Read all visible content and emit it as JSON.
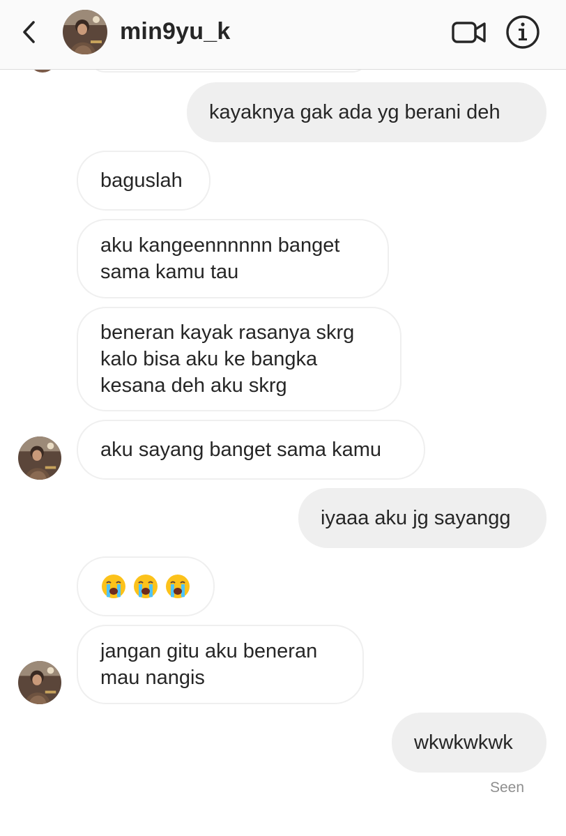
{
  "header": {
    "username": "min9yu_k",
    "icons": {
      "back": "chevron-left-icon",
      "video": "video-camera-icon",
      "info": "info-circle-icon"
    }
  },
  "messages": [
    {
      "side": "out",
      "text": "kayaknya gak ada yg berani deh"
    },
    {
      "side": "in",
      "text": "baguslah"
    },
    {
      "side": "in",
      "text": "aku kangeennnnnn banget\nsama kamu tau"
    },
    {
      "side": "in",
      "text": "beneran kayak rasanya skrg\nkalo bisa aku ke bangka\nkesana deh aku skrg"
    },
    {
      "side": "in",
      "text": "aku sayang banget sama kamu"
    },
    {
      "side": "out",
      "text": "iyaaa aku jg sayangg"
    },
    {
      "side": "in",
      "text": "😭😭😭"
    },
    {
      "side": "in",
      "text": "jangan gitu aku beneran\nmau nangis"
    },
    {
      "side": "out",
      "text": "wkwkwkwk"
    }
  ],
  "status": {
    "seen": "Seen"
  },
  "colors": {
    "incoming_border": "#efefef",
    "outgoing_bg": "#efefef",
    "text": "#262626",
    "muted": "#8e8e8e"
  }
}
